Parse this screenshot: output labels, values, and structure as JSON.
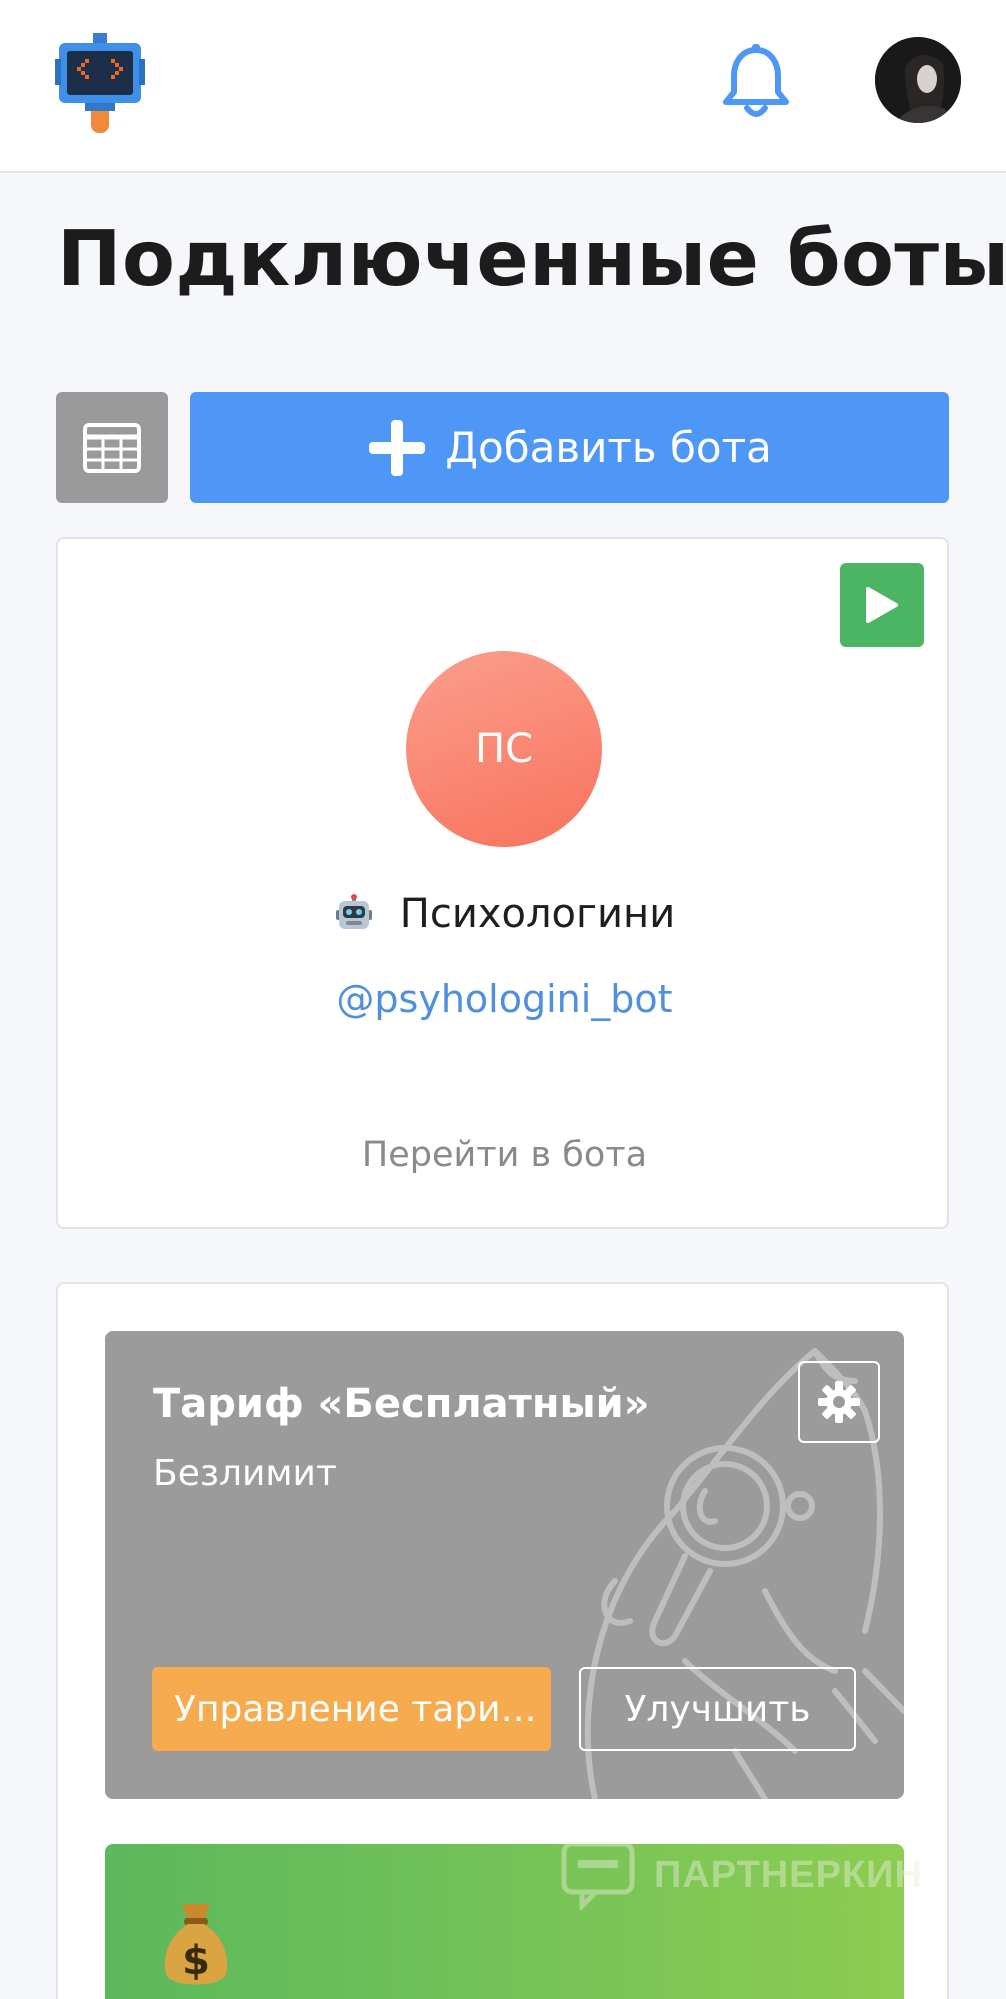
{
  "header": {
    "logo_icon": "pixel-robot-logo-icon",
    "bell_icon": "bell-icon",
    "avatar_icon": "user-avatar"
  },
  "page_title": "Подключенные боты",
  "toolbar": {
    "grid_icon": "table-grid-icon",
    "add_button_label": "Добавить бота"
  },
  "bot": {
    "initials": "ПС",
    "name": "Психологини",
    "handle": "@psyhologini_bot",
    "goto_label": "Перейти в бота",
    "robot_icon": "robot-emoji-icon",
    "play_icon": "play-icon"
  },
  "tariff": {
    "title": "Тариф «Бесплатный»",
    "subtitle": "Безлимит",
    "manage_label": "Управление тари…",
    "upgrade_label": "Улучшить",
    "gear_icon": "gear-icon"
  },
  "partner": {
    "icon": "money-bag-icon",
    "watermark": "ПАРТНЕРКИН"
  },
  "colors": {
    "accent_blue": "#4f97f6",
    "play_green": "#4cb563",
    "tariff_gray": "#9b9b9b",
    "manage_orange": "#f7ab4f",
    "handle_blue": "#4f8fdf"
  }
}
